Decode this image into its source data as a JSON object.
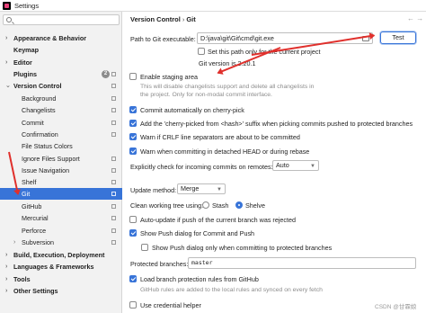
{
  "window": {
    "title": "Settings"
  },
  "sidebar": {
    "search_placeholder": "",
    "items": [
      {
        "label": "Appearance & Behavior",
        "chevron": "›"
      },
      {
        "label": "Keymap"
      },
      {
        "label": "Editor",
        "chevron": "›"
      },
      {
        "label": "Plugins",
        "badge": "2"
      },
      {
        "label": "Version Control",
        "chevron": "⌄"
      },
      {
        "label": "Background"
      },
      {
        "label": "Changelists"
      },
      {
        "label": "Commit"
      },
      {
        "label": "Confirmation"
      },
      {
        "label": "File Status Colors"
      },
      {
        "label": "Ignore Files Support"
      },
      {
        "label": "Issue Navigation"
      },
      {
        "label": "Shelf"
      },
      {
        "label": "Git"
      },
      {
        "label": "GitHub"
      },
      {
        "label": "Mercurial"
      },
      {
        "label": "Perforce"
      },
      {
        "label": "Subversion",
        "chevron": "›"
      },
      {
        "label": "Build, Execution, Deployment",
        "chevron": "›"
      },
      {
        "label": "Languages & Frameworks",
        "chevron": "›"
      },
      {
        "label": "Tools",
        "chevron": "›"
      },
      {
        "label": "Other Settings",
        "chevron": "›"
      }
    ]
  },
  "header": {
    "crumb1": "Version Control",
    "sep": "›",
    "crumb2": "Git",
    "back": "←",
    "forward": "→"
  },
  "git_path": {
    "label": "Path to Git executable:",
    "value": "D:\\java\\git\\Git\\cmd\\git.exe",
    "test_button": "Test",
    "project_only": "Set this path only for the current project",
    "version": "Git version is 2.20.1"
  },
  "options": {
    "staging": "Enable staging area",
    "staging_hint1": "This will disable changelists support and delete all changelists in",
    "staging_hint2": "the project. Only for non-modal commit interface.",
    "cherry_pick": "Commit automatically on cherry-pick",
    "cherry_suffix": "Add the 'cherry-picked from <hash>' suffix when picking commits pushed to protected branches",
    "crlf": "Warn if CRLF line separators are about to be committed",
    "detached": "Warn when committing in detached HEAD or during rebase",
    "incoming_label": "Explicitly check for incoming commits on remotes:",
    "incoming_value": "Auto",
    "update_label": "Update method:",
    "update_value": "Merge",
    "clean_label": "Clean working tree using:",
    "stash": "Stash",
    "shelve": "Shelve",
    "auto_update": "Auto-update if push of the current branch was rejected",
    "push_dialog": "Show Push dialog for Commit and Push",
    "push_protected": "Show Push dialog only when committing to protected branches",
    "protected_label": "Protected branches:",
    "protected_value": "master",
    "load_rules": "Load branch protection rules from GitHub",
    "load_hint": "GitHub rules are added to the local rules and synced on every fetch",
    "credential": "Use credential helper"
  },
  "watermark": "CSDN @甘霖娘",
  "colors": {
    "accent": "#3874d8",
    "annotation": "#e0302c"
  }
}
